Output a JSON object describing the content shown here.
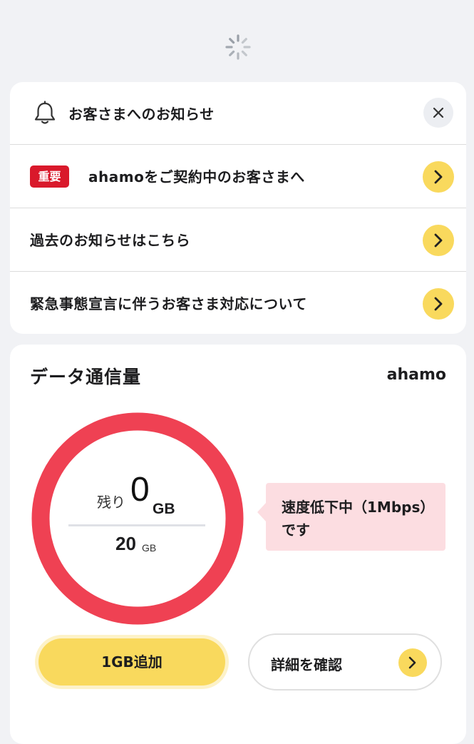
{
  "notices": {
    "header": "お客さまへのお知らせ",
    "items": [
      {
        "badge": "重要",
        "label": "ahamoをご契約中のお客さまへ"
      },
      {
        "label": "過去のお知らせはこちら"
      },
      {
        "label": "緊急事態宣言に伴うお客さま対応について"
      }
    ]
  },
  "data_usage": {
    "title": "データ通信量",
    "plan": "ahamo",
    "remaining_label": "残り",
    "remaining_value": "0",
    "remaining_unit": "GB",
    "total_value": "20",
    "total_unit": "GB",
    "remaining_fraction": 0,
    "speed_notice": "速度低下中（1Mbps）です",
    "add_button": "1GB追加",
    "detail_button": "詳細を確認"
  },
  "colors": {
    "accent_yellow": "#f9d95d",
    "gauge_red": "#ef4153",
    "badge_red": "#d9192b",
    "notice_pink": "#fcdde1"
  },
  "icons": [
    "loading-spinner-icon",
    "bell-icon",
    "close-icon",
    "chevron-right-icon"
  ]
}
